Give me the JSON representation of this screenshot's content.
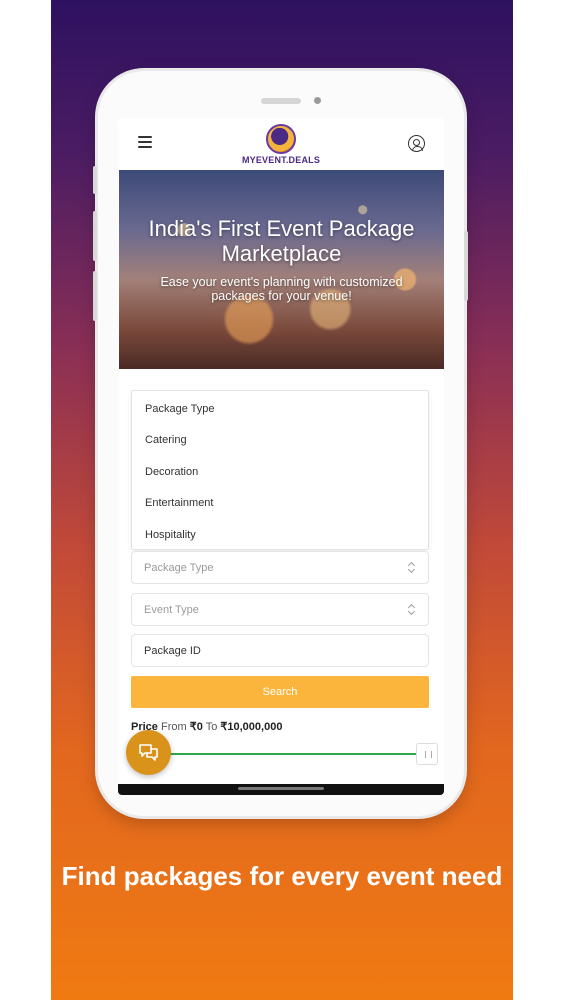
{
  "header": {
    "menu_icon": "hamburger-icon",
    "logo_text": "MYEVENT.DEALS",
    "profile_icon": "user-circle-icon"
  },
  "hero": {
    "title": "India's First Event Package Marketplace",
    "subtitle": "Ease your event's planning with customized packages for your venue!"
  },
  "dropdown": {
    "items": [
      "Package Type",
      "Catering",
      "Decoration",
      "Entertainment",
      "Hospitality"
    ]
  },
  "form": {
    "package_type_placeholder": "Package Type",
    "event_type_placeholder": "Event Type",
    "package_id_label": "Package ID",
    "search_label": "Search"
  },
  "price": {
    "label": "Price",
    "from_word": "From",
    "from_value": "₹0",
    "to_word": "To",
    "to_value": "₹10,000,000"
  },
  "tagline": "Find packages for every event need",
  "colors": {
    "accent": "#fbb53c",
    "slider": "#2ea84a",
    "brand": "#4b2a86",
    "fab": "#d9921a"
  }
}
